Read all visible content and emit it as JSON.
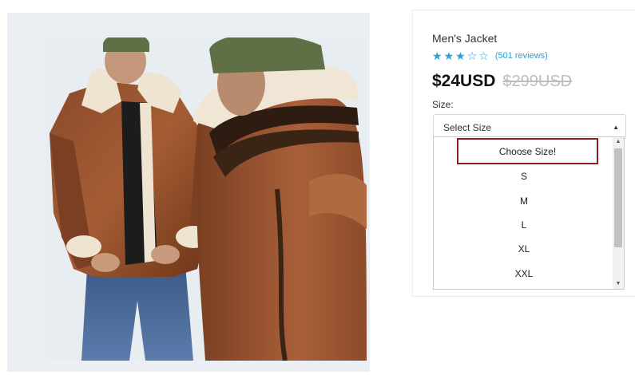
{
  "product": {
    "title": "Men's Jacket",
    "rating_stars_filled": 3,
    "rating_stars_total": 5,
    "reviews": "(501 reviews)",
    "price": "$24USD",
    "old_price": "$299USD",
    "size_label": "Size:"
  },
  "size_select": {
    "value": "Select Size",
    "caret_icon": "triangle-down-icon",
    "options": [
      "Choose Size!",
      "S",
      "M",
      "L",
      "XL",
      "XXL"
    ],
    "highlighted_option": "Choose Size!"
  },
  "colors": {
    "accent_blue": "#2a9fd8",
    "highlight_border": "#8e1d22",
    "button_orange": "#f2a93b"
  }
}
